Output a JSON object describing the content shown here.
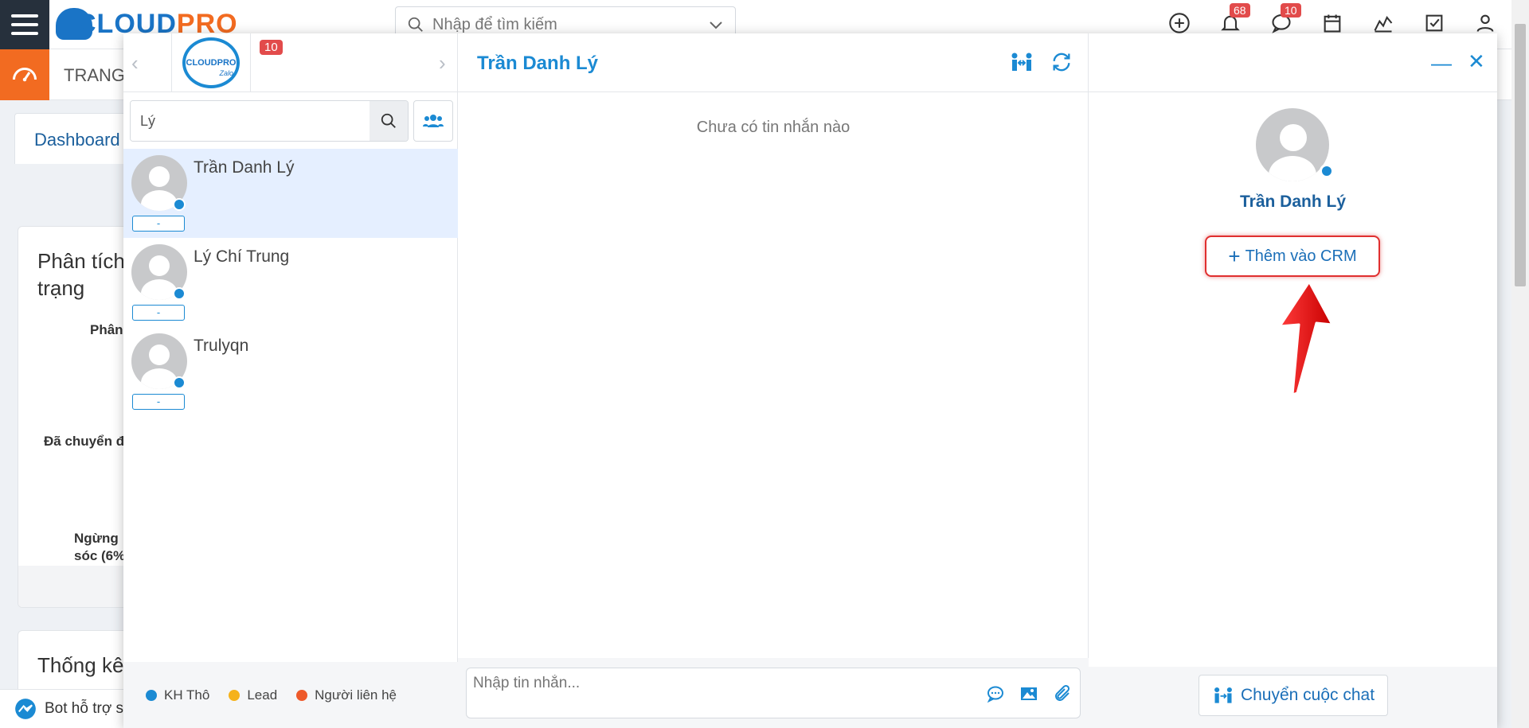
{
  "app": {
    "logo_prefix": "CLOUD",
    "logo_suffix": "PRO",
    "search_placeholder": "Nhập để tìm kiếm",
    "notification_count": "68",
    "message_count": "10",
    "page_title": "TRANG",
    "dashboard_tab": "Dashboard",
    "card1_title": "Phân tích trạng",
    "card1_labels": [
      "Phân",
      "Đã chuyển đ",
      "Ngừng",
      "sóc (6%)"
    ],
    "card2_title": "Thống kê",
    "bot_label": "Bot hỗ trợ s"
  },
  "chat": {
    "account_badge": "10",
    "account_logo": "CLOUDPRO",
    "account_sub": "Zalo",
    "search_value": "Lý",
    "contacts": [
      {
        "name": "Trần Danh Lý",
        "tag": "-"
      },
      {
        "name": "Lý Chí Trung",
        "tag": "-"
      },
      {
        "name": "Trulyqn",
        "tag": "-"
      }
    ],
    "legend": [
      {
        "label": "KH Thô",
        "color": "#1b8ad3"
      },
      {
        "label": "Lead",
        "color": "#f5b21b"
      },
      {
        "label": "Người liên hệ",
        "color": "#ee5a2b"
      }
    ],
    "conversation_title": "Trần Danh Lý",
    "empty_message": "Chưa có tin nhắn nào",
    "composer_placeholder": "Nhập tin nhắn...",
    "profile_name": "Trần Danh Lý",
    "add_crm_label": "Thêm vào CRM",
    "transfer_label": "Chuyển cuộc chat"
  }
}
